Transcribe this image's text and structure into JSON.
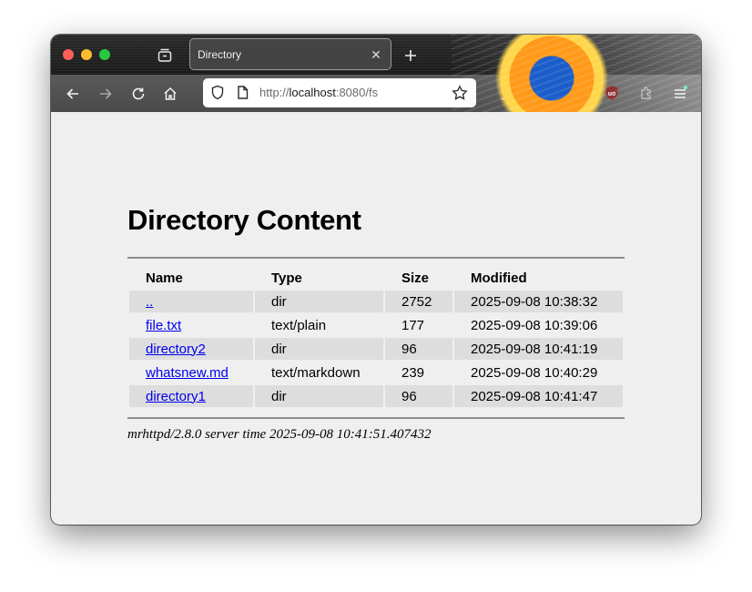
{
  "browser": {
    "tab": {
      "title": "Directory"
    },
    "url": {
      "scheme": "http://",
      "host": "localhost",
      "rest": ":8080/fs"
    },
    "extensions": {
      "lastpass_badge": "L"
    }
  },
  "page": {
    "heading": "Directory Content",
    "columns": [
      "Name",
      "Type",
      "Size",
      "Modified"
    ],
    "rows": [
      {
        "name": "..",
        "type": "dir",
        "size": "2752",
        "modified": "2025-09-08 10:38:32"
      },
      {
        "name": "file.txt",
        "type": "text/plain",
        "size": "177",
        "modified": "2025-09-08 10:39:06"
      },
      {
        "name": "directory2",
        "type": "dir",
        "size": "96",
        "modified": "2025-09-08 10:41:19"
      },
      {
        "name": "whatsnew.md",
        "type": "text/markdown",
        "size": "239",
        "modified": "2025-09-08 10:40:29"
      },
      {
        "name": "directory1",
        "type": "dir",
        "size": "96",
        "modified": "2025-09-08 10:41:47"
      }
    ],
    "footer": "mrhttpd/2.8.0 server time 2025-09-08 10:41:51.407432"
  },
  "colors": {
    "link": "#0000ee",
    "row_shade": "#dddddd",
    "page_bg": "#efefef"
  }
}
